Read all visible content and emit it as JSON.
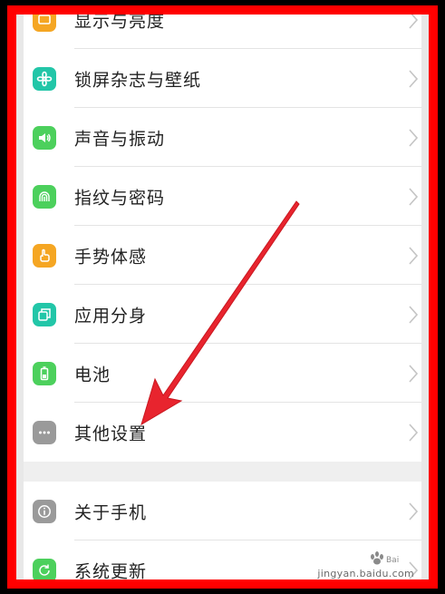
{
  "settings": {
    "items": [
      {
        "label": "显示与亮度",
        "icon": "display-icon",
        "color": "#f5a623"
      },
      {
        "label": "锁屏杂志与壁纸",
        "icon": "flower-icon",
        "color": "#22c6a8"
      },
      {
        "label": "声音与振动",
        "icon": "speaker-icon",
        "color": "#4cd05c"
      },
      {
        "label": "指纹与密码",
        "icon": "fingerprint-icon",
        "color": "#4cd05c"
      },
      {
        "label": "手势体感",
        "icon": "hand-icon",
        "color": "#f5a623"
      },
      {
        "label": "应用分身",
        "icon": "clone-icon",
        "color": "#22c6a8"
      },
      {
        "label": "电池",
        "icon": "battery-icon",
        "color": "#4cd05c"
      },
      {
        "label": "其他设置",
        "icon": "more-dots-icon",
        "color": "#9a9a9a"
      }
    ],
    "items2": [
      {
        "label": "关于手机",
        "icon": "info-icon",
        "color": "#9a9a9a"
      },
      {
        "label": "系统更新",
        "icon": "update-icon",
        "color": "#4cd05c"
      }
    ]
  },
  "annotation": {
    "color": "#e8242e"
  },
  "frame": {
    "color": "#ff0000"
  },
  "watermark": {
    "text": "jingyan.baidu.com"
  }
}
